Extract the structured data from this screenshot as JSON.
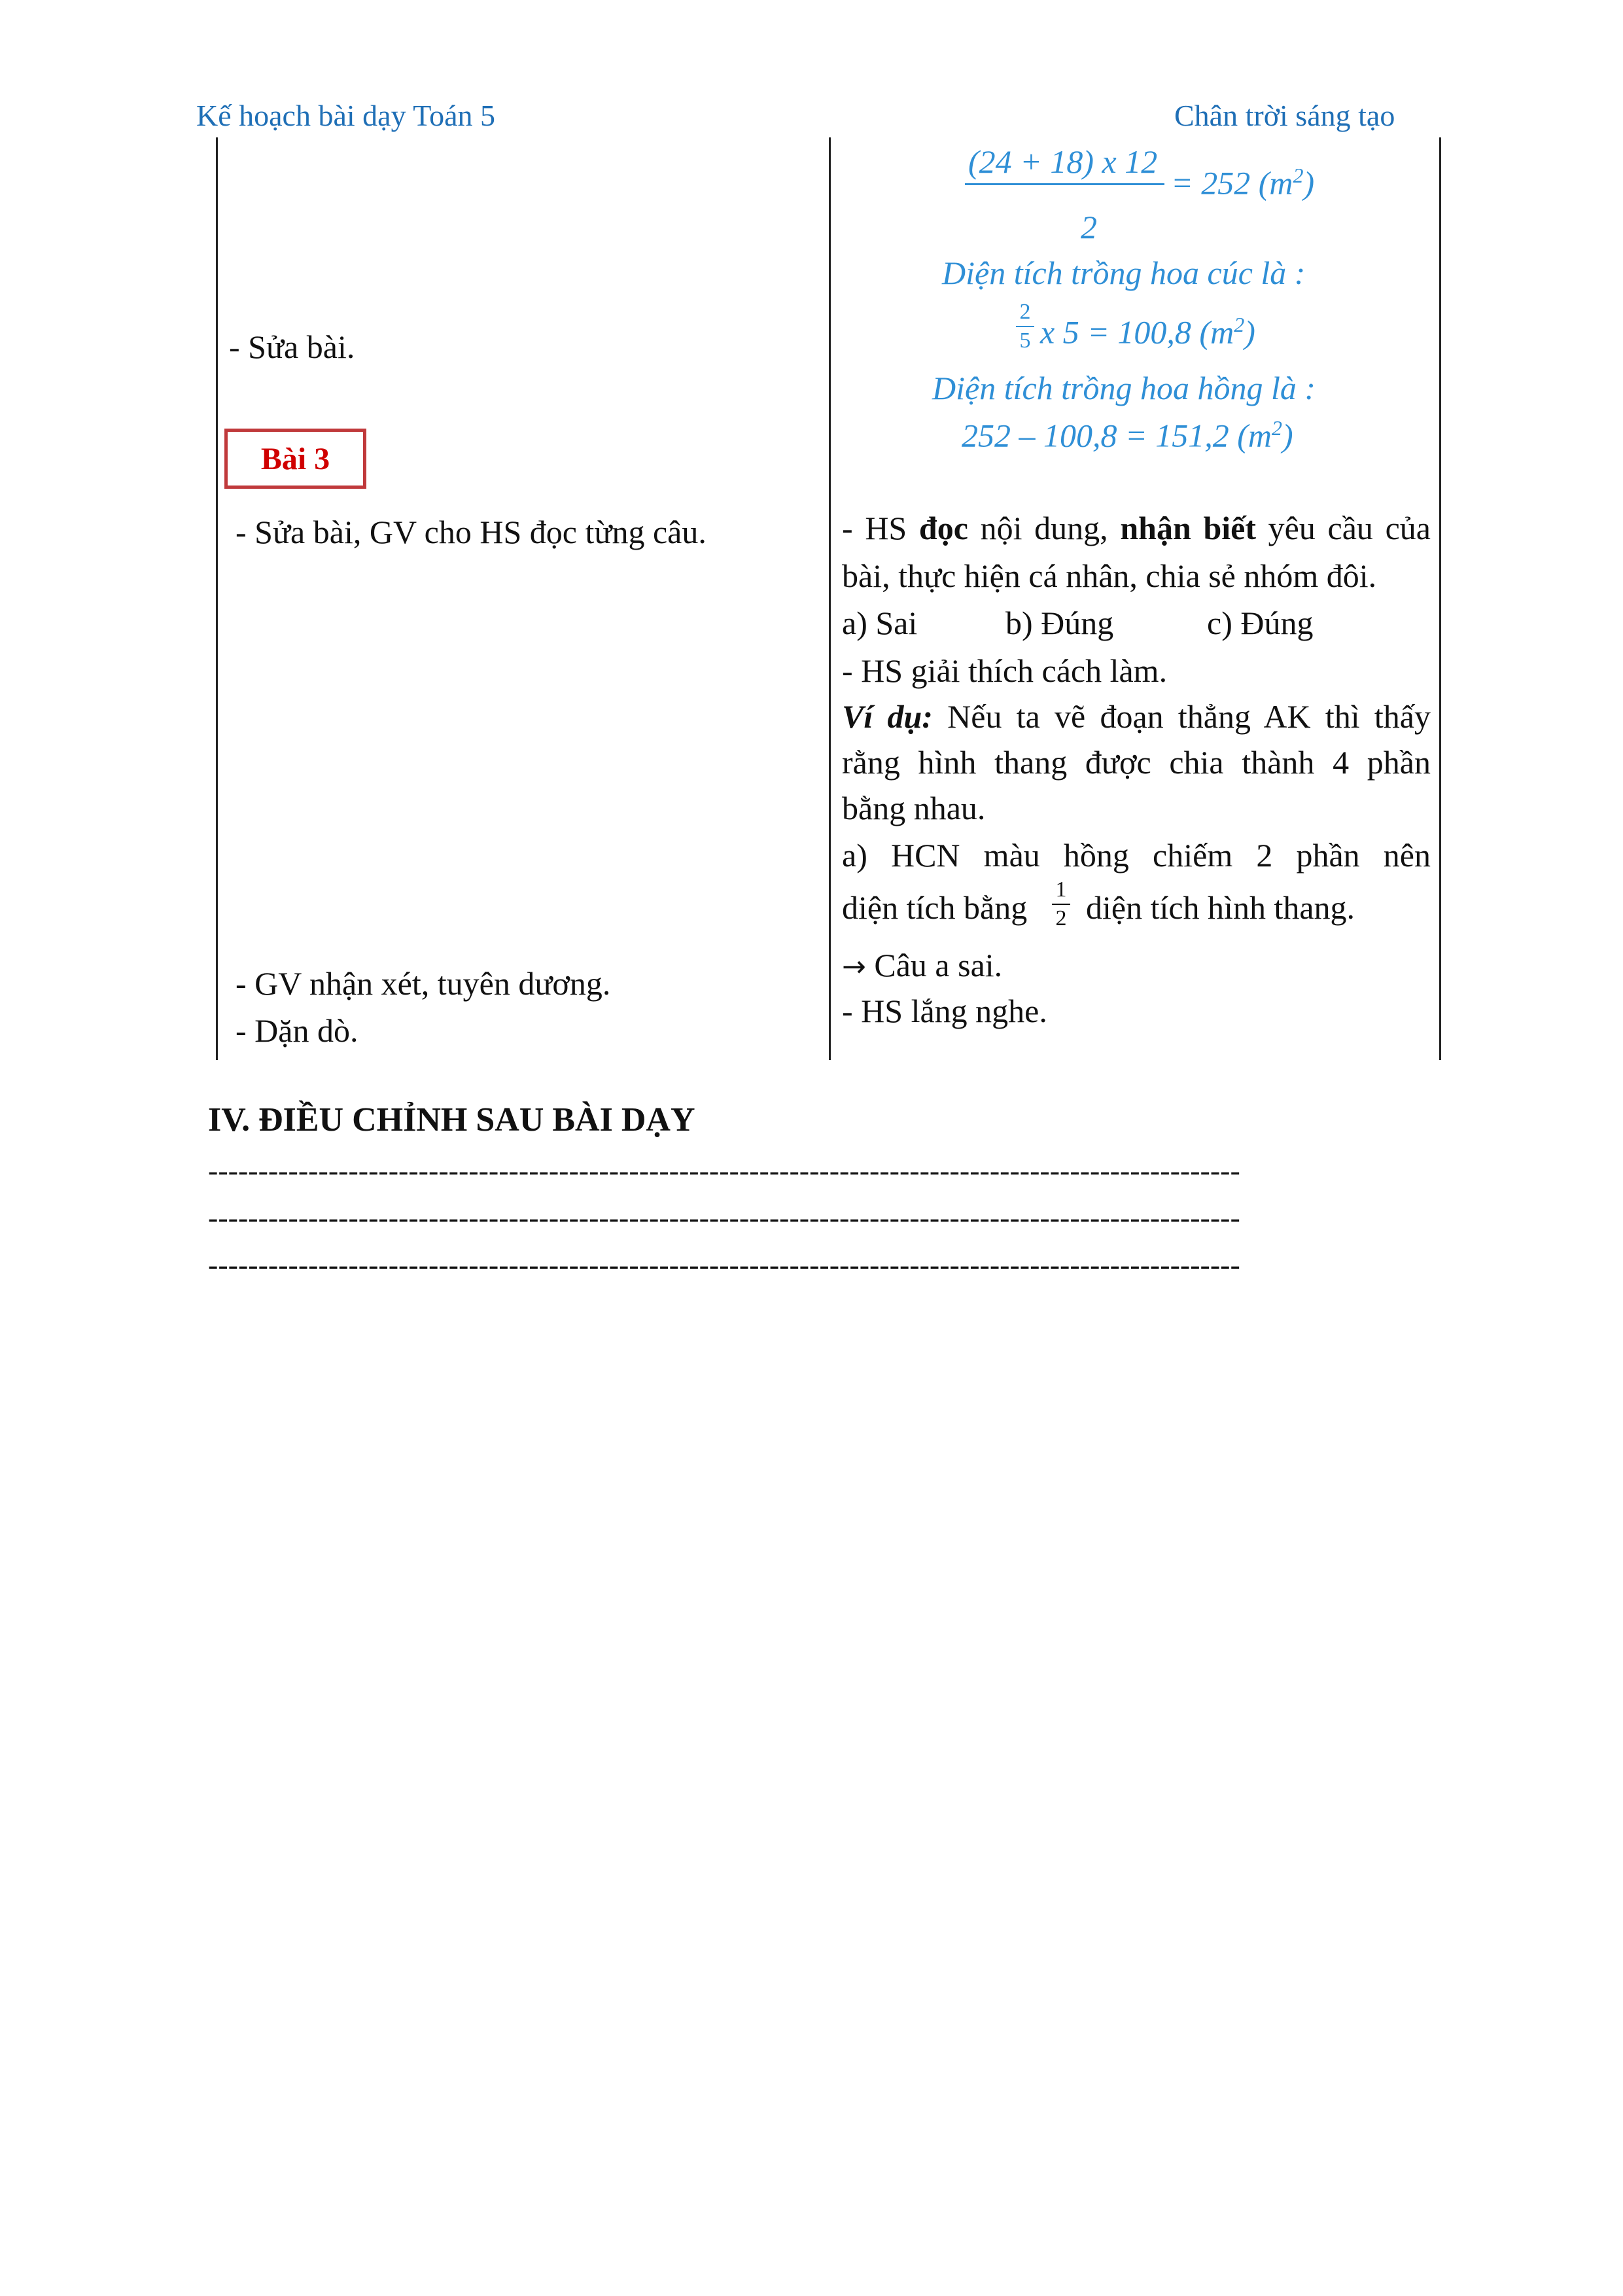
{
  "header": {
    "left": "Kế hoạch bài dạy Toán 5",
    "right": "Chân trời sáng tạo"
  },
  "left_col": {
    "sua_bai_1": "- Sửa bài.",
    "bai3_label": "Bài 3",
    "sua_bai_2": "- Sửa bài, GV cho HS đọc từng câu.",
    "nhan_xet": "- GV nhận xét, tuyên dương.",
    "dan_do": "- Dặn dò."
  },
  "right_col": {
    "formula1": {
      "numerator": "(24 + 18) x 12",
      "result": "= 252 (m",
      "exp": "2",
      "close": ")",
      "denominator": "2"
    },
    "cuc_title": "Diện tích trồng hoa cúc là :",
    "formula2": {
      "num": "2",
      "den": "5",
      "rest": "x 5 = 100,8 (m",
      "exp": "2",
      "close": ")"
    },
    "hong_title": "Diện tích trồng hoa hồng là :",
    "formula3": {
      "text": "252 – 100,8 = 151,2 (m",
      "exp": "2",
      "close": ")"
    },
    "hs_line1_a": "- HS ",
    "hs_line1_b": "đọc",
    "hs_line1_c": " nội dung, ",
    "hs_line1_d": "nhận biết",
    "hs_line1_e": " yêu cầu của",
    "hs_line2": "bài, thực hiện cá nhân, chia sẻ nhóm đôi.",
    "ans_a": "a) Sai",
    "ans_b": "b) Đúng",
    "ans_c": "c) Đúng",
    "giai_thich": "- HS giải thích cách làm.",
    "vidu_label": "Ví dụ:",
    "vidu_rest": " Nếu ta vẽ đoạn thẳng AK thì thấy",
    "vidu_line2": "rằng hình thang được chia thành 4 phần",
    "vidu_line3": "bằng nhau.",
    "hcn_line1": "a) HCN màu hồng chiếm 2 phần nên",
    "hcn_line2a": "diện tích bằng",
    "half_num": "1",
    "half_den": "2",
    "hcn_line2b": "diện tích hình thang.",
    "arrow": "→",
    "cau_a_sai": "Câu a sai.",
    "lang_nghe": "- HS lắng nghe."
  },
  "section": {
    "title": "IV. ĐIỀU CHỈNH SAU BÀI DẠY",
    "dashes": [
      "-------------------------------------------------------------------------------------------------------",
      "-------------------------------------------------------------------------------------------------------",
      "-------------------------------------------------------------------------------------------------------"
    ]
  }
}
